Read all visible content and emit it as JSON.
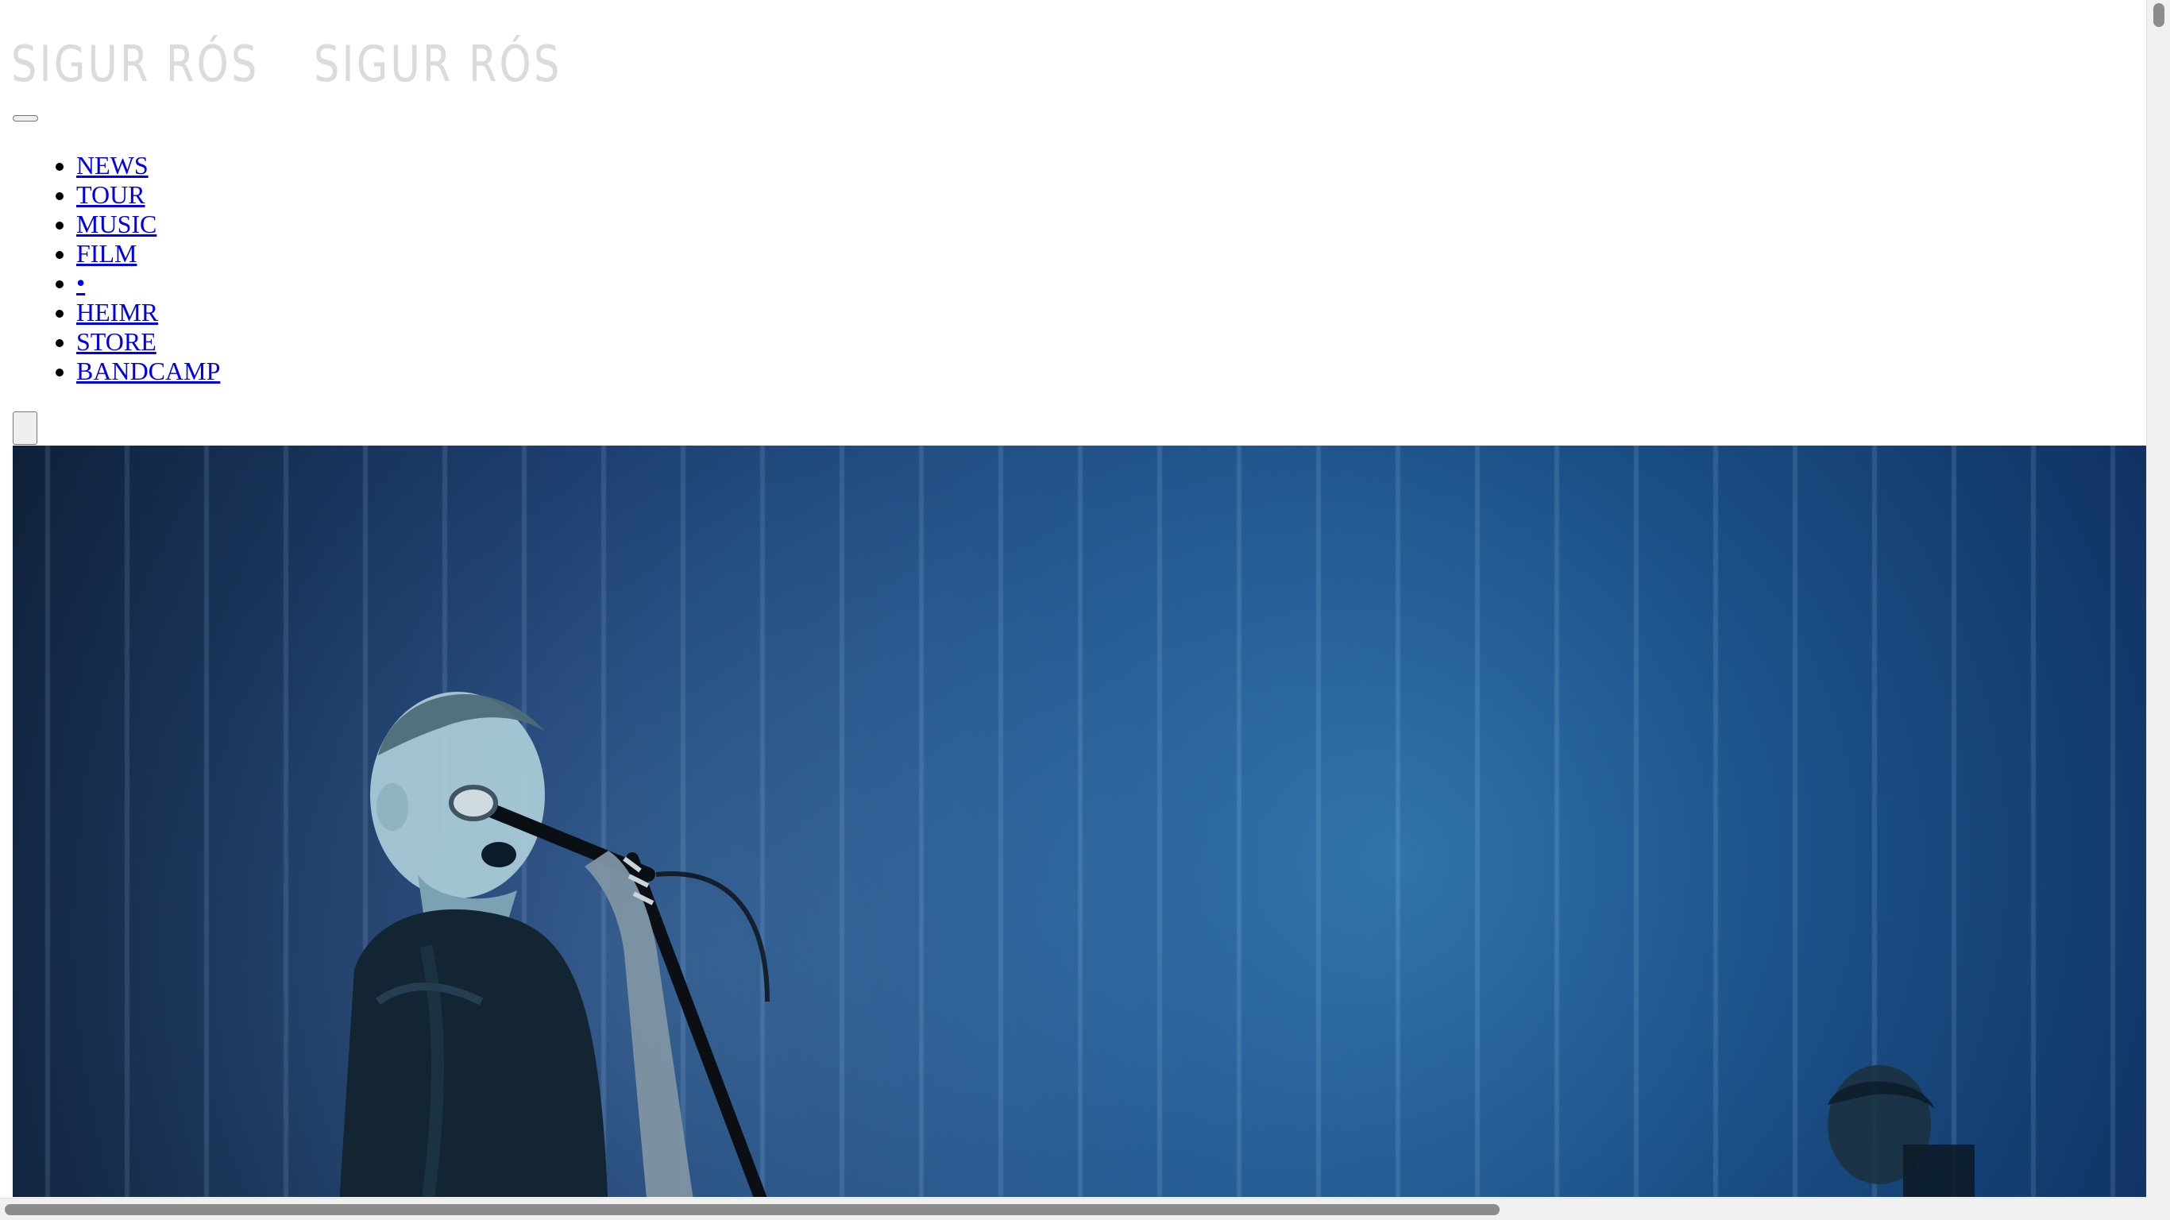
{
  "site": {
    "logo_text_1": "SIGUR RÓS",
    "logo_text_2": "SIGUR RÓS"
  },
  "nav": {
    "items": [
      {
        "label": "NEWS"
      },
      {
        "label": "TOUR"
      },
      {
        "label": "MUSIC"
      },
      {
        "label": "FILM"
      },
      {
        "label": "•"
      },
      {
        "label": "HEIMR"
      },
      {
        "label": "STORE"
      },
      {
        "label": "BANDCAMP"
      }
    ]
  },
  "colors": {
    "link": "#0000ee",
    "logo": "#d8d8d8",
    "hero_blue": "#1a4f86"
  },
  "icons": {
    "menu_toggle": "hamburger-icon",
    "hero": "concert-photo"
  }
}
